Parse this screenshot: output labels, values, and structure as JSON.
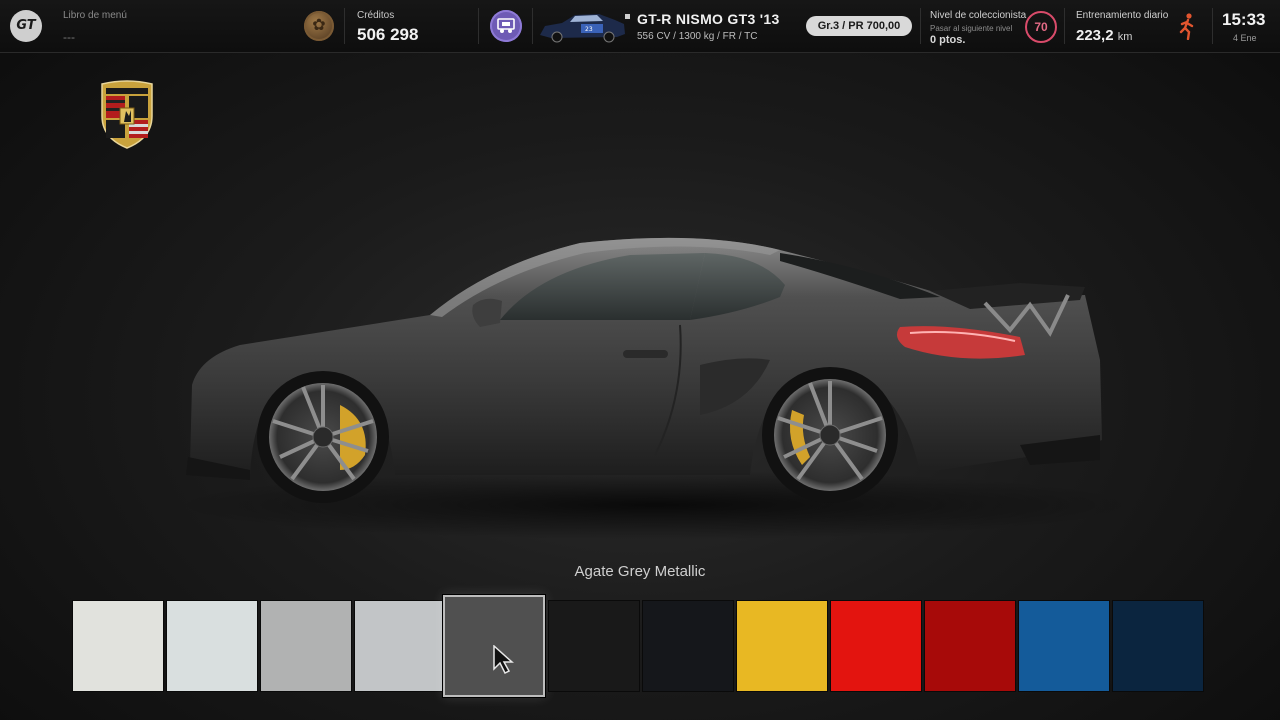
{
  "topbar": {
    "menu_book_label": "Libro de menú",
    "menu_book_value": "---",
    "credits_label": "Créditos",
    "credits_value": "506 298",
    "car_name": "GT-R NISMO GT3 '13",
    "car_specs": "556 CV / 1300 kg / FR / TC",
    "pr_badge": "Gr.3 / PR 700,00",
    "collector_label": "Nivel de coleccionista",
    "collector_sub": "Pasar al siguiente nivel",
    "collector_points": "0 ptos.",
    "collector_level": "70",
    "training_label": "Entrenamiento diario",
    "training_value": "223,2",
    "training_unit": "km",
    "time": "15:33",
    "date": "4 Ene"
  },
  "stage": {
    "selected_color_name": "Agate Grey Metallic"
  },
  "swatches": [
    {
      "color": "#e1e2dd"
    },
    {
      "color": "#d9dfdf"
    },
    {
      "color": "#b1b2b2"
    },
    {
      "color": "#c2c5c7"
    },
    {
      "color": "#505050",
      "selected": true
    },
    {
      "color": "#191919"
    },
    {
      "color": "#15171b"
    },
    {
      "color": "#e8b823"
    },
    {
      "color": "#e3140f"
    },
    {
      "color": "#a70a09"
    },
    {
      "color": "#145b9a"
    },
    {
      "color": "#0b253f"
    }
  ],
  "colors": {
    "accent_level": "#d94b6a",
    "runner_icon": "#e2552f",
    "garage_icon": "#6e5bb5"
  }
}
